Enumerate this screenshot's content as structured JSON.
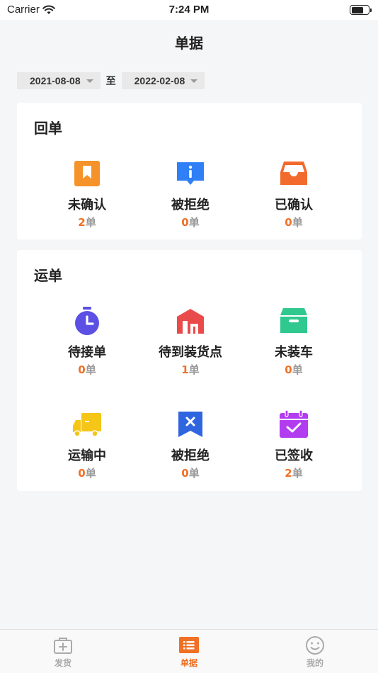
{
  "status_bar": {
    "carrier": "Carrier",
    "time": "7:24 PM",
    "battery_level": 0.7
  },
  "header": {
    "title": "单据"
  },
  "date_range": {
    "start": "2021-08-08",
    "separator": "至",
    "end": "2022-02-08"
  },
  "receipt_section": {
    "title": "回单",
    "unit": "单",
    "items": [
      {
        "label": "未确认",
        "count": "2",
        "icon": "bookmark-icon",
        "color": "#f5932a"
      },
      {
        "label": "被拒绝",
        "count": "0",
        "icon": "info-chat-icon",
        "color": "#2f7ff7"
      },
      {
        "label": "已确认",
        "count": "0",
        "icon": "inbox-icon",
        "color": "#f26a2c"
      }
    ]
  },
  "waybill_section": {
    "title": "运单",
    "unit": "单",
    "items": [
      {
        "label": "待接单",
        "count": "0",
        "icon": "stopwatch-icon",
        "color": "#5b50e3"
      },
      {
        "label": "待到装货点",
        "count": "1",
        "icon": "warehouse-icon",
        "color": "#e94a4a"
      },
      {
        "label": "未装车",
        "count": "0",
        "icon": "box-icon",
        "color": "#2fc88f"
      },
      {
        "label": "运输中",
        "count": "0",
        "icon": "truck-icon",
        "color": "#f5c518"
      },
      {
        "label": "被拒绝",
        "count": "0",
        "icon": "rejected-bookmark-icon",
        "color": "#2f66e0"
      },
      {
        "label": "已签收",
        "count": "2",
        "icon": "calendar-check-icon",
        "color": "#b23cf0"
      }
    ]
  },
  "tab_bar": {
    "tabs": [
      {
        "label": "发货",
        "icon": "medical-box-icon",
        "active": false
      },
      {
        "label": "单据",
        "icon": "document-list-icon",
        "active": true
      },
      {
        "label": "我的",
        "icon": "smiley-icon",
        "active": false
      }
    ]
  },
  "colors": {
    "accent": "#f07024",
    "muted": "#999999",
    "background": "#f5f6f7"
  }
}
